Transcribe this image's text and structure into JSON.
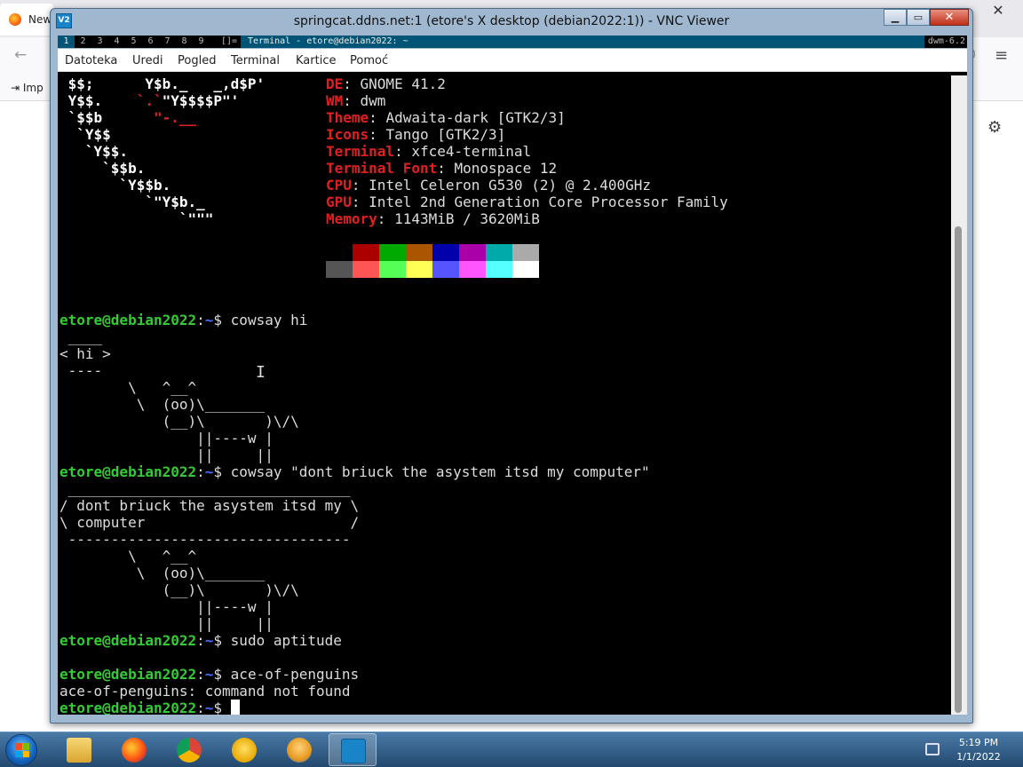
{
  "browser": {
    "tab_label": "New",
    "import_label": "Imp",
    "url_fragment": "0",
    "back_icon": "arrow-left-icon",
    "menu_icon": "hamburger-icon",
    "gear_icon": "gear-icon"
  },
  "vnc": {
    "title": "springcat.ddns.net:1 (etore's X desktop (debian2022:1)) - VNC Viewer",
    "icon_text": "V2",
    "minimize_label": "▁",
    "maximize_label": "▭",
    "close_label": "✕"
  },
  "dwm": {
    "tags": [
      "1",
      "2",
      "3",
      "4",
      "5",
      "6",
      "7",
      "8",
      "9"
    ],
    "active_tag": "1",
    "layout_symbol": "[]=",
    "window_title": "Terminal - etore@debian2022: ~",
    "status": "dwm-6.2"
  },
  "terminal": {
    "menu": [
      "Datoteka",
      "Uredi",
      "Pogled",
      "Terminal",
      "Kartice",
      "Pomoć"
    ],
    "neofetch_logo": [
      " $$;      Y$b._   _,d$P'",
      " Y$$.    `.`\"Y$$$$P\"'",
      " `$$b      \"-.__",
      "  `Y$$",
      "   `Y$$.",
      "     `$$b.",
      "       `Y$$b.",
      "          `\"Y$b._",
      "              `\"\"\""
    ],
    "neofetch_info": [
      {
        "key": "DE",
        "value": ": GNOME 41.2"
      },
      {
        "key": "WM",
        "value": ": dwm"
      },
      {
        "key": "Theme",
        "value": ": Adwaita-dark [GTK2/3]"
      },
      {
        "key": "Icons",
        "value": ": Tango [GTK2/3]"
      },
      {
        "key": "Terminal",
        "value": ": xfce4-terminal"
      },
      {
        "key": "Terminal Font",
        "value": ": Monospace 12"
      },
      {
        "key": "CPU",
        "value": ": Intel Celeron G530 (2) @ 2.400GHz"
      },
      {
        "key": "GPU",
        "value": ": Intel 2nd Generation Core Processor Family"
      },
      {
        "key": "Memory",
        "value": ": 1143MiB / 3620MiB"
      }
    ],
    "palette_row1": [
      "#000000",
      "#aa0000",
      "#00aa00",
      "#aa5500",
      "#0000aa",
      "#aa00aa",
      "#00aaaa",
      "#aaaaaa"
    ],
    "palette_row2": [
      "#555555",
      "#ff5555",
      "#55ff55",
      "#ffff55",
      "#5555ff",
      "#ff55ff",
      "#55ffff",
      "#ffffff"
    ],
    "prompt_user": "etore@debian2022",
    "prompt_path": "~",
    "prompt_sep": ":",
    "prompt_dollar": "$ ",
    "commands": [
      "cowsay hi",
      "cowsay \"dont briuck the asystem itsd my computer\"",
      "sudo aptitude",
      "ace-of-penguins"
    ],
    "cow1": [
      " ____",
      "< hi >",
      " ----",
      "        \\   ^__^",
      "         \\  (oo)\\_______",
      "            (__)\\       )\\/\\",
      "                ||----w |",
      "                ||     ||"
    ],
    "cow2": [
      " _________________________________",
      "/ dont briuck the asystem itsd my \\",
      "\\ computer                        /",
      " ---------------------------------",
      "        \\   ^__^",
      "         \\  (oo)\\_______",
      "            (__)\\       )\\/\\",
      "                ||----w |",
      "                ||     ||"
    ],
    "error_line": "ace-of-penguins: command not found",
    "ibeam": "I"
  },
  "taskbar": {
    "apps": [
      {
        "name": "explorer",
        "icon": "folder-icon"
      },
      {
        "name": "firefox",
        "icon": "firefox-icon"
      },
      {
        "name": "chrome",
        "icon": "chrome-icon"
      },
      {
        "name": "cheese",
        "icon": "smiley-icon"
      },
      {
        "name": "thunderbird",
        "icon": "mail-bird-icon"
      },
      {
        "name": "vnc-viewer",
        "icon": "vnc-icon"
      }
    ],
    "time": "5:19 PM",
    "date": "1/1/2022"
  }
}
